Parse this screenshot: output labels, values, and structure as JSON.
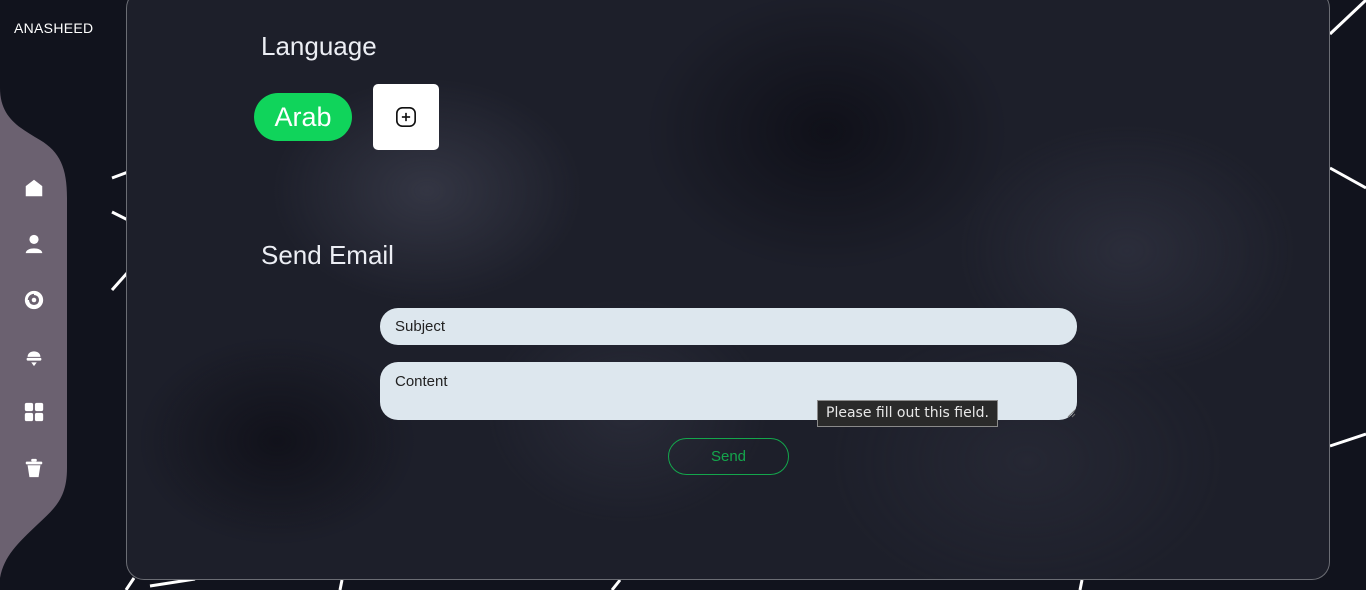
{
  "app": {
    "brand": "ANASHEED"
  },
  "sidebar": {
    "items": [
      {
        "icon": "home-icon"
      },
      {
        "icon": "user-icon"
      },
      {
        "icon": "disc-icon"
      },
      {
        "icon": "bell-icon"
      },
      {
        "icon": "grid-icon"
      },
      {
        "icon": "trash-icon"
      }
    ]
  },
  "language": {
    "title": "Language",
    "selected": "Arab",
    "add_icon": "add-square-icon"
  },
  "email": {
    "title": "Send Email",
    "subject_placeholder": "Subject",
    "content_placeholder": "Content",
    "send_label": "Send",
    "validation_tooltip": "Please fill out this field."
  },
  "colors": {
    "accent": "#10d45b",
    "send": "#14a64c",
    "sidebar": "#6b6170",
    "field": "#dde7ee"
  }
}
